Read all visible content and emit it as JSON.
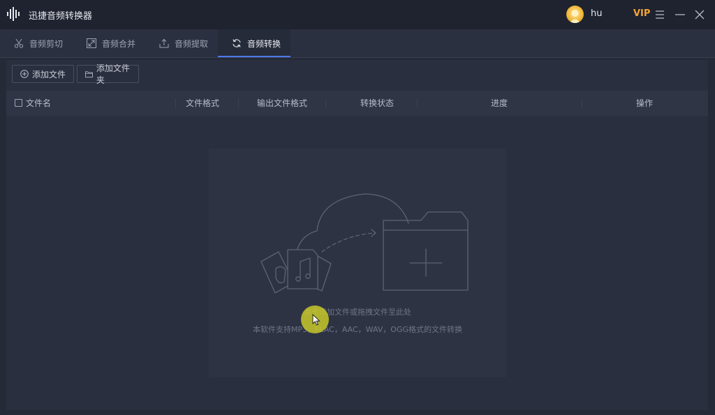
{
  "app": {
    "title": "迅捷音频转换器"
  },
  "user": {
    "name": "hu",
    "vip_label": "VIP"
  },
  "colors": {
    "accent": "#4b7bec",
    "vip": "#f3a533",
    "background": "#252a39",
    "titlebar": "#1f2330"
  },
  "window_controls": [
    {
      "icon": "menu-icon"
    },
    {
      "icon": "minimize-icon"
    },
    {
      "icon": "close-icon"
    }
  ],
  "tabs": [
    {
      "label": "音频剪切",
      "icon": "scissors-icon",
      "active": false
    },
    {
      "label": "音频合并",
      "icon": "merge-icon",
      "active": false
    },
    {
      "label": "音频提取",
      "icon": "upload-icon",
      "active": false
    },
    {
      "label": "音频转换",
      "icon": "refresh-icon",
      "active": true
    }
  ],
  "toolbar": {
    "add_file": "添加文件",
    "add_folder": "添加文件夹"
  },
  "table": {
    "columns": [
      "文件名",
      "文件格式",
      "输出文件格式",
      "转换状态",
      "进度",
      "操作"
    ],
    "rows": []
  },
  "drop_zone": {
    "line1": "点击添加文件或拖拽文件至此处",
    "line2": "本软件支持MP3，FLAC，AAC，WAV，OGG格式的文件转换"
  }
}
